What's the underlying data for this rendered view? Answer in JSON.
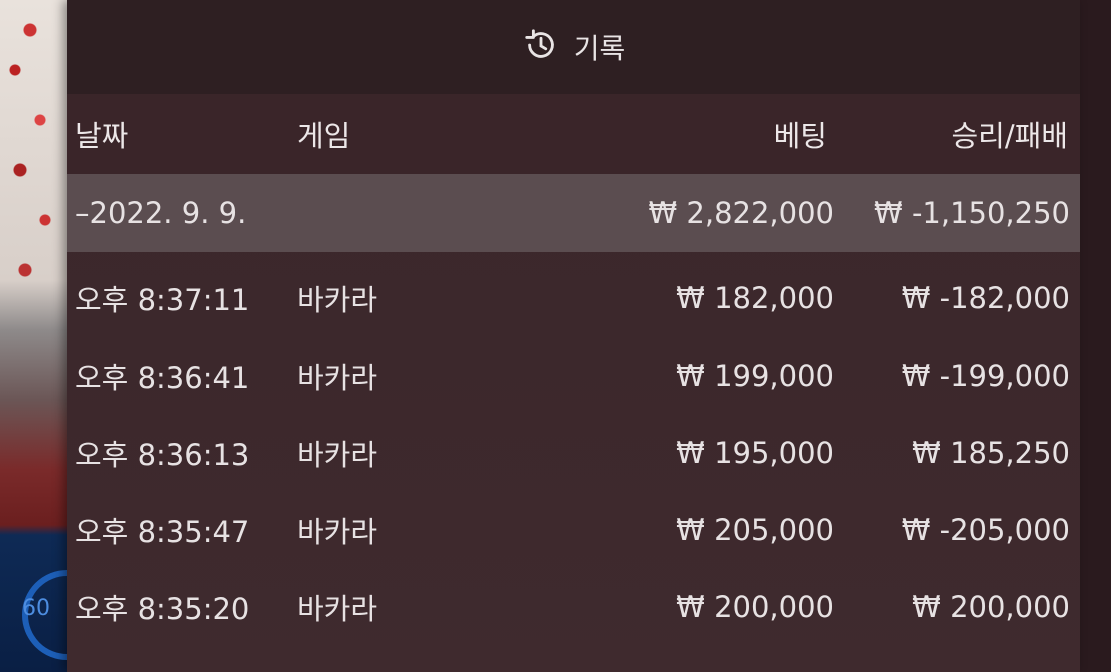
{
  "header": {
    "title": "기록",
    "icon": "history-icon"
  },
  "background": {
    "gauge_text": "60"
  },
  "columns": {
    "date": "날짜",
    "game": "게임",
    "bet": "베팅",
    "win_loss": "승리/패배"
  },
  "summary": {
    "date": "–2022. 9. 9.",
    "bet": "₩ 2,822,000",
    "win_loss": "₩ -1,150,250"
  },
  "rows": [
    {
      "time": "오후 8:37:11",
      "game": "바카라",
      "bet": "₩ 182,000",
      "win_loss": "₩ -182,000"
    },
    {
      "time": "오후 8:36:41",
      "game": "바카라",
      "bet": "₩ 199,000",
      "win_loss": "₩ -199,000"
    },
    {
      "time": "오후 8:36:13",
      "game": "바카라",
      "bet": "₩ 195,000",
      "win_loss": "₩ 185,250"
    },
    {
      "time": "오후 8:35:47",
      "game": "바카라",
      "bet": "₩ 205,000",
      "win_loss": "₩ -205,000"
    },
    {
      "time": "오후 8:35:20",
      "game": "바카라",
      "bet": "₩ 200,000",
      "win_loss": "₩ 200,000"
    }
  ]
}
